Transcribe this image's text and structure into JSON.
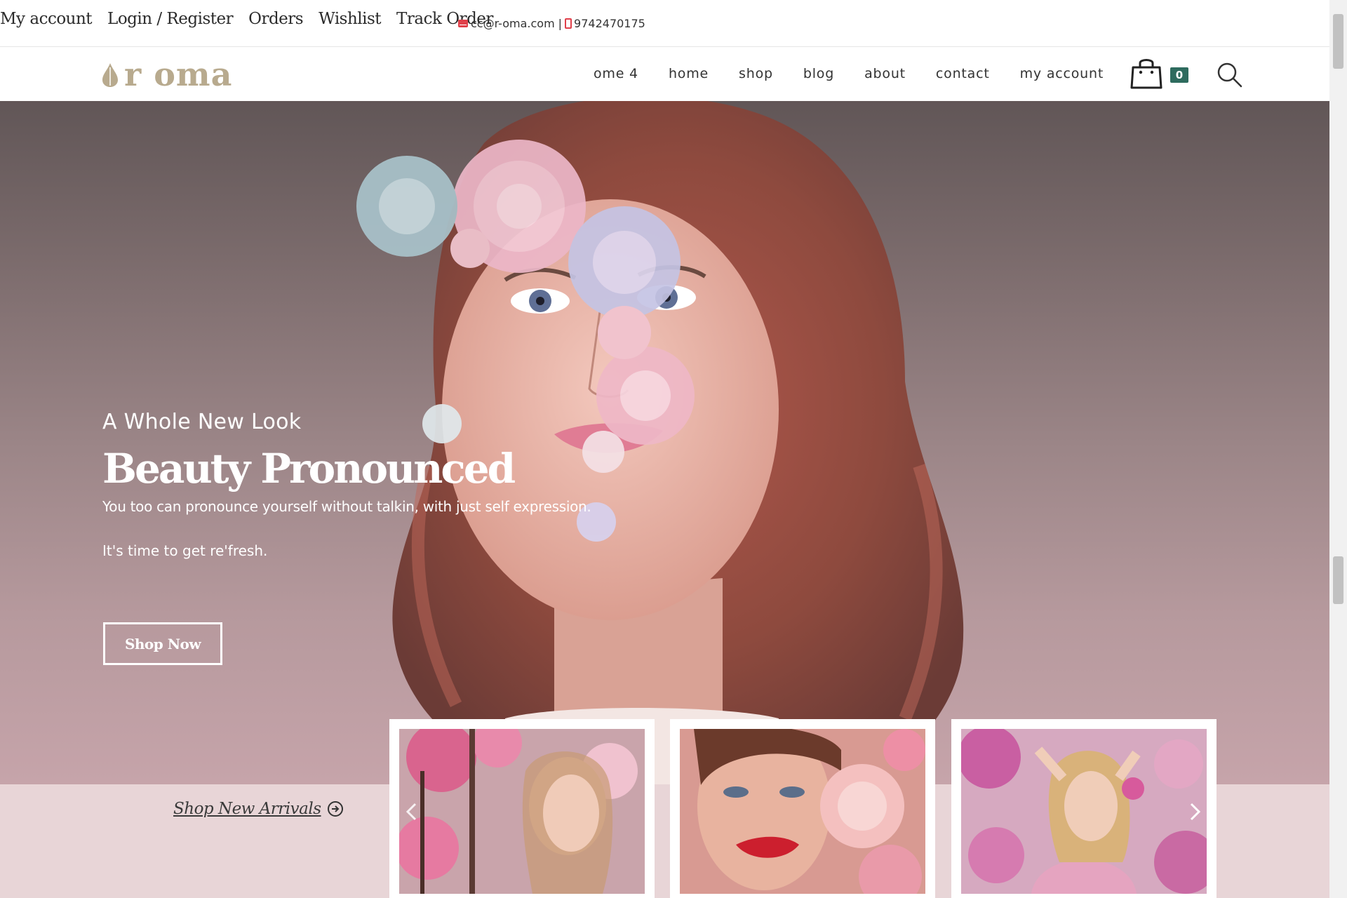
{
  "topbar": {
    "links": [
      "My account",
      "Login / Register",
      "Orders",
      "Wishlist",
      "Track Order"
    ],
    "email": "cc@r-oma.com",
    "separator": "|",
    "phone": "9742470175"
  },
  "header": {
    "logo_text": "r oma",
    "nav": [
      "ome 4",
      "home",
      "shop",
      "blog",
      "about",
      "contact",
      "my account"
    ],
    "cart_count": "0"
  },
  "hero": {
    "subtitle": "A Whole New Look",
    "title": "Beauty Pronounced",
    "text1": "You too can pronounce yourself without talkin, with just self expression.",
    "text2": "It's time to get re'fresh.",
    "button": "Shop Now"
  },
  "arrivals": {
    "link": "Shop New Arrivals"
  },
  "colors": {
    "accent": "#b8aa8e",
    "badge": "#2e6b5e",
    "strip": "#e8d5d7",
    "contact_icon": "#e0404a"
  }
}
